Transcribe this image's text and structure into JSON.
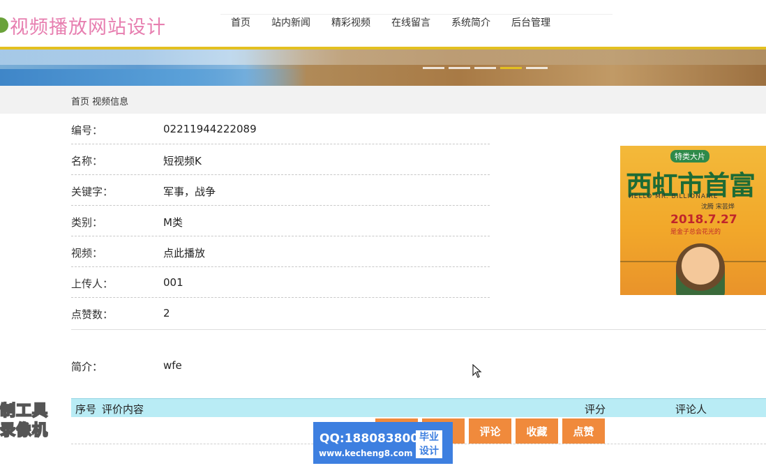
{
  "site": {
    "title": "视频播放网站设计"
  },
  "nav": [
    "首页",
    "站内新闻",
    "精彩视频",
    "在线留言",
    "系统简介",
    "后台管理"
  ],
  "breadcrumb": "首页 视频信息",
  "detail": {
    "rows": [
      {
        "label": "编号：",
        "value": "02211944222089"
      },
      {
        "label": "名称：",
        "value": "短视频K"
      },
      {
        "label": "关键字：",
        "value": "军事，战争"
      },
      {
        "label": "类别：",
        "value": "M类"
      },
      {
        "label": "视频：",
        "value": "点此播放"
      },
      {
        "label": "上传人：",
        "value": "001"
      },
      {
        "label": "点赞数：",
        "value": "2"
      }
    ],
    "description_label": "简介：",
    "description": "wfe"
  },
  "poster": {
    "tag": "特类大片",
    "title": "西虹市首富",
    "english": "HELLO MR. BILLIONAIRE",
    "cast": "沈腾 宋芸烨",
    "date": "2018.7.27",
    "slogan": "是金子总会花光的"
  },
  "comments": {
    "col_index": "序号",
    "col_content": "评价内容",
    "col_score": "评分",
    "col_user": "评论人"
  },
  "actions": [
    "",
    "",
    "评论",
    "收藏",
    "点赞"
  ],
  "overlay": {
    "qq": "QQ:188083800",
    "url": "www.kecheng8.com",
    "badge_line1": "毕业",
    "badge_line2": "设计",
    "watermark_line1": "制工具",
    "watermark_line2": "录像机"
  },
  "colors": {
    "accent": "#f08a3c",
    "brand": "#e77fb0",
    "bar": "#e3c020",
    "table_head": "#b9ecf5"
  }
}
